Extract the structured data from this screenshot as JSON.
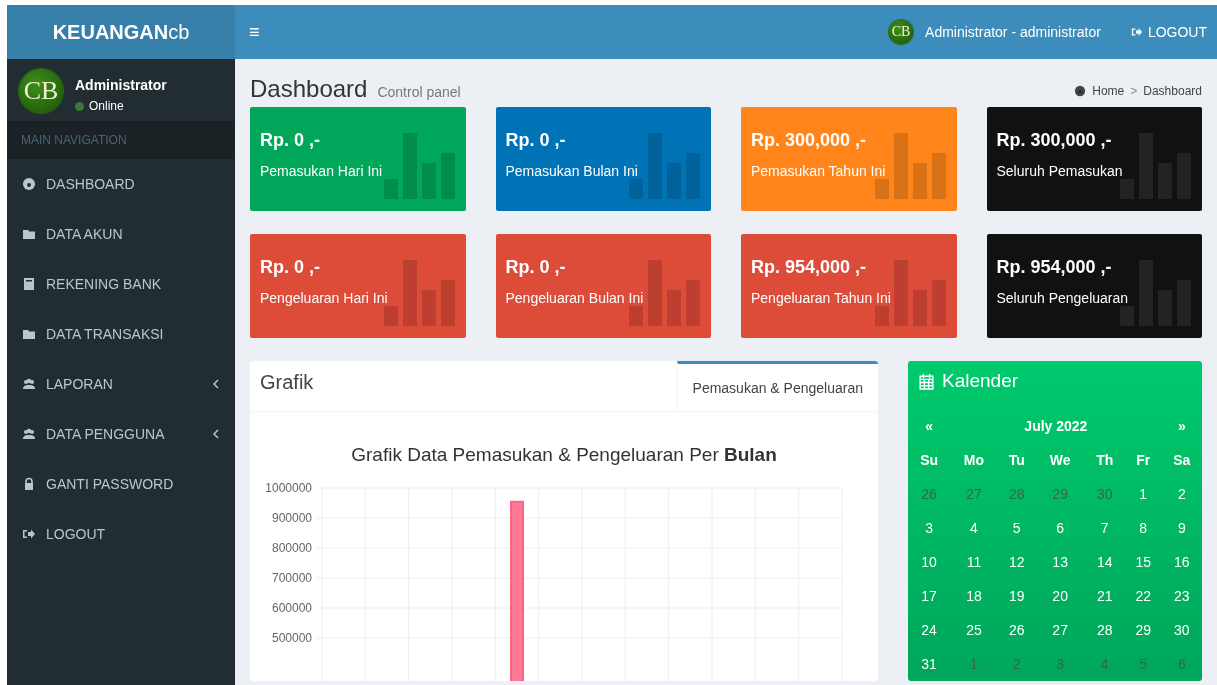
{
  "header": {
    "logo_main": "KEUANGAN",
    "logo_suffix": "cb",
    "menu_toggle": "≡",
    "user_avatar": "CB",
    "user_name": "Administrator - administrator",
    "logout": "LOGOUT"
  },
  "sidebar": {
    "avatar": "CB",
    "user": "Administrator",
    "status": "Online",
    "nav_header": "MAIN NAVIGATION",
    "items": [
      {
        "label": "DASHBOARD",
        "submenu": false
      },
      {
        "label": "DATA AKUN",
        "submenu": false
      },
      {
        "label": "REKENING BANK",
        "submenu": false
      },
      {
        "label": "DATA TRANSAKSI",
        "submenu": false
      },
      {
        "label": "LAPORAN",
        "submenu": true
      },
      {
        "label": "DATA PENGGUNA",
        "submenu": true
      },
      {
        "label": "GANTI PASSWORD",
        "submenu": false
      },
      {
        "label": "LOGOUT",
        "submenu": false
      }
    ]
  },
  "page": {
    "title": "Dashboard",
    "subtitle": "Control panel",
    "breadcrumb": [
      "Home",
      "Dashboard"
    ],
    "breadcrumb_separator": ">"
  },
  "stats": [
    {
      "value": "Rp. 0 ,-",
      "label": "Pemasukan Hari Ini",
      "color": "#00a65a"
    },
    {
      "value": "Rp. 0 ,-",
      "label": "Pemasukan Bulan Ini",
      "color": "#0073b7"
    },
    {
      "value": "Rp. 300,000 ,-",
      "label": "Pemasukan Tahun Ini",
      "color": "#ff851b"
    },
    {
      "value": "Rp. 300,000 ,-",
      "label": "Seluruh Pemasukan",
      "color": "#111111"
    },
    {
      "value": "Rp. 0 ,-",
      "label": "Pengeluaran Hari Ini",
      "color": "#dd4b39"
    },
    {
      "value": "Rp. 0 ,-",
      "label": "Pengeluaran Bulan Ini",
      "color": "#dd4b39"
    },
    {
      "value": "Rp. 954,000 ,-",
      "label": "Pengeluaran Tahun Ini",
      "color": "#dd4b39"
    },
    {
      "value": "Rp. 954,000 ,-",
      "label": "Seluruh Pengeluaran",
      "color": "#111111"
    }
  ],
  "chart_panel": {
    "title": "Grafik",
    "tabs": [
      {
        "label": "Pemasukan & Pengeluaran",
        "selected": true
      }
    ],
    "chart_data": {
      "type": "bar",
      "grid": true,
      "title": "Grafik Data Pemasukan & Pengeluaran Per **Bulan**",
      "ylim": [
        0,
        1000000
      ],
      "yticks": [
        500000,
        600000,
        700000,
        800000,
        900000,
        1000000
      ],
      "series": [
        {
          "color": "#ff6384",
          "values": [
            0,
            0,
            0,
            0,
            954000,
            0,
            0,
            0,
            0,
            0,
            0,
            0
          ]
        }
      ]
    }
  },
  "calendar": {
    "title": "Kalender",
    "prev": "«",
    "next": "»",
    "month": "July 2022",
    "weekdays": [
      "Su",
      "Mo",
      "Tu",
      "We",
      "Th",
      "Fr",
      "Sa"
    ],
    "weeks": [
      [
        {
          "d": "26",
          "muted": true
        },
        {
          "d": "27",
          "muted": true
        },
        {
          "d": "28",
          "muted": true
        },
        {
          "d": "29",
          "muted": true
        },
        {
          "d": "30",
          "muted": true
        },
        {
          "d": "1",
          "muted": false
        },
        {
          "d": "2",
          "muted": false
        }
      ],
      [
        {
          "d": "3",
          "muted": false
        },
        {
          "d": "4",
          "muted": false
        },
        {
          "d": "5",
          "muted": false
        },
        {
          "d": "6",
          "muted": false
        },
        {
          "d": "7",
          "muted": false
        },
        {
          "d": "8",
          "muted": false
        },
        {
          "d": "9",
          "muted": false
        }
      ],
      [
        {
          "d": "10",
          "muted": false
        },
        {
          "d": "11",
          "muted": false
        },
        {
          "d": "12",
          "muted": false
        },
        {
          "d": "13",
          "muted": false
        },
        {
          "d": "14",
          "muted": false
        },
        {
          "d": "15",
          "muted": false
        },
        {
          "d": "16",
          "muted": false
        }
      ],
      [
        {
          "d": "17",
          "muted": false
        },
        {
          "d": "18",
          "muted": false
        },
        {
          "d": "19",
          "muted": false
        },
        {
          "d": "20",
          "muted": false
        },
        {
          "d": "21",
          "muted": false
        },
        {
          "d": "22",
          "muted": false
        },
        {
          "d": "23",
          "muted": false
        }
      ],
      [
        {
          "d": "24",
          "muted": false
        },
        {
          "d": "25",
          "muted": false
        },
        {
          "d": "26",
          "muted": false
        },
        {
          "d": "27",
          "muted": false
        },
        {
          "d": "28",
          "muted": false
        },
        {
          "d": "29",
          "muted": false
        },
        {
          "d": "30",
          "muted": false
        }
      ],
      [
        {
          "d": "31",
          "muted": false
        },
        {
          "d": "1",
          "muted": true
        },
        {
          "d": "2",
          "muted": true
        },
        {
          "d": "3",
          "muted": true
        },
        {
          "d": "4",
          "muted": true
        },
        {
          "d": "5",
          "muted": true
        },
        {
          "d": "6",
          "muted": true
        }
      ]
    ]
  }
}
